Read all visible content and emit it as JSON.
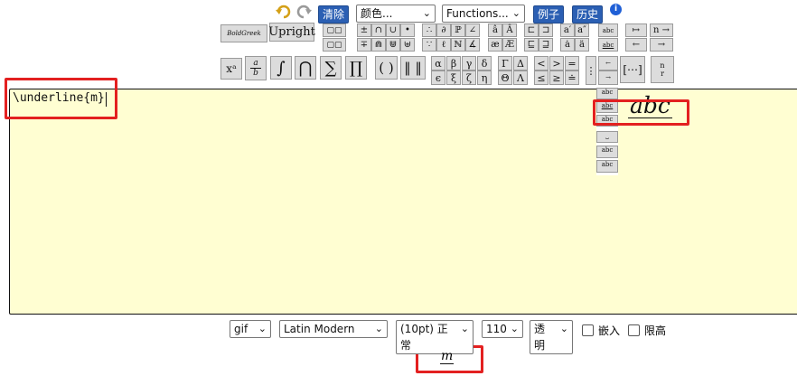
{
  "toolbar": {
    "clear_label": "清除",
    "color_select": "颜色...",
    "functions_select": "Functions...",
    "examples_label": "例子",
    "history_label": "历史"
  },
  "symbols": {
    "bold_greek": "BoldGreek",
    "upright": "Upright",
    "superscript": "xᵃ",
    "fraction_top": "a",
    "fraction_bottom": "b",
    "integral": "∫",
    "intersection": "⋂",
    "sum": "∑",
    "product": "∏",
    "parens": "( )",
    "norm": "‖ ‖",
    "alpha": "α",
    "beta": "β",
    "gamma": "γ",
    "delta": "δ",
    "epsilon": "ϵ",
    "xi": "ξ",
    "zeta": "ζ",
    "eta": "η",
    "Gamma": "Γ",
    "Delta": "Δ",
    "Theta": "Θ",
    "Lambda": "Λ",
    "lt": "<",
    "gt": ">",
    "eq": "=",
    "le": "≤",
    "ge": "≥",
    "doteq": "≐",
    "abc": "abc",
    "mapsto": "↦",
    "n_to": "n →",
    "leftarrow": "←",
    "rightarrow": "→",
    "binom_n": "n",
    "binom_r": "r",
    "partial": "∂",
    "bbP": "ℙ",
    "angle": "∠",
    "ell": "ℓ",
    "bbN": "ℕ",
    "measured_angle": "∡",
    "pm": "±",
    "cap": "∩",
    "cup": "∪",
    "uplus": "⊎",
    "mp": "∓",
    "bullet": "•",
    "ae": "æ",
    "AE": "Æ",
    "a_dot": "ȧ",
    "a_ddot": "ä",
    "a_prime": "a′",
    "a_dprime": "a″",
    "a_hat": "â",
    "A_hat": "Â"
  },
  "editor": {
    "input_text": "\\underline{m}",
    "preview_text": "abc"
  },
  "bottom": {
    "format": "gif",
    "font": "Latin Modern",
    "size": "(10pt) 正常",
    "dpi": "110",
    "transparency": "透明",
    "embed_label": "嵌入",
    "limit_label": "限高",
    "result": "m"
  }
}
